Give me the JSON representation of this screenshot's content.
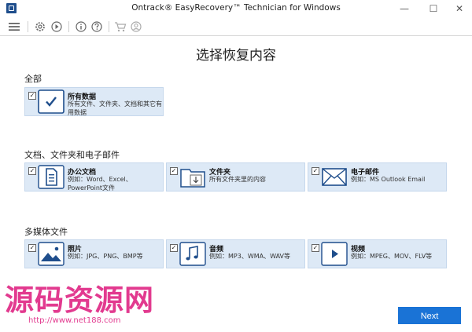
{
  "window": {
    "title": "Ontrack® EasyRecovery™ Technician for Windows",
    "minimize": "—",
    "maximize": "☐",
    "close": "✕"
  },
  "toolbar": {
    "icons": [
      "menu-icon",
      "settings-icon",
      "resume-icon",
      "info-icon",
      "help-icon",
      "cart-icon",
      "user-icon"
    ]
  },
  "page_title": "选择恢复内容",
  "sections": {
    "all": {
      "label": "全部",
      "cards": [
        {
          "title": "所有数据",
          "desc": "所有文件、文件夹、文档和其它有用数据",
          "checked": "✓",
          "icon": "checkmark-icon"
        }
      ]
    },
    "documents": {
      "label": "文档、文件夹和电子邮件",
      "cards": [
        {
          "title": "办公文档",
          "desc": "例如：Word、Excel、PowerPoint文件",
          "checked": "✓",
          "icon": "document-icon"
        },
        {
          "title": "文件夹",
          "desc": "所有文件夹里的内容",
          "checked": "✓",
          "icon": "folder-icon"
        },
        {
          "title": "电子邮件",
          "desc": "例如：MS Outlook Email",
          "checked": "✓",
          "icon": "email-icon"
        }
      ]
    },
    "media": {
      "label": "多媒体文件",
      "cards": [
        {
          "title": "照片",
          "desc": "例如：JPG、PNG、BMP等",
          "checked": "✓",
          "icon": "photo-icon"
        },
        {
          "title": "音频",
          "desc": "例如：MP3、WMA、WAV等",
          "checked": "✓",
          "icon": "music-icon"
        },
        {
          "title": "视频",
          "desc": "例如：MPEG、MOV、FLV等",
          "checked": "✓",
          "icon": "video-icon"
        }
      ]
    }
  },
  "next_label": "Next",
  "watermark": {
    "text": "源码资源网",
    "url": "http://www.net188.com"
  },
  "colors": {
    "card_bg": "#dde9f6",
    "card_border": "#c6d8ec",
    "icon_blue": "#1f4e8c",
    "button_blue": "#1a73d6",
    "watermark": "#e23a8f"
  }
}
